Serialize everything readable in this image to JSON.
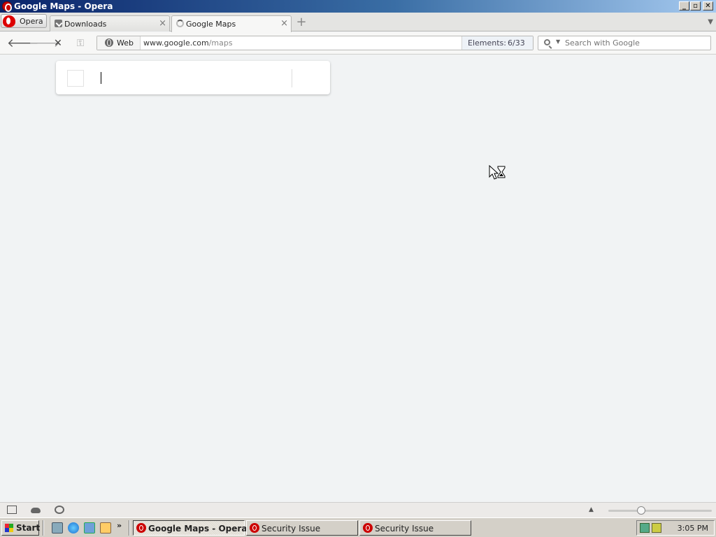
{
  "window": {
    "title": "Google Maps - Opera"
  },
  "tabbar": {
    "opera_menu_label": "Opera",
    "tabs": [
      {
        "label": "Downloads",
        "close": "×"
      },
      {
        "label": "Google Maps",
        "close": "×"
      }
    ],
    "new_tab": "+"
  },
  "navbar": {
    "back": "🡐",
    "forward": "🡒",
    "stop": "✕",
    "badge_label": "Web",
    "url_host": "www.google.com",
    "url_path": "/maps",
    "elements_label": "Elements:",
    "elements_count": "6/33",
    "search_placeholder": "Search with Google"
  },
  "maps": {
    "search_value": ""
  },
  "statusbar": {
    "up_arrow": "▲",
    "zoom_level": 0.3
  },
  "taskbar": {
    "start_label": "Start",
    "more": "»",
    "tasks": [
      {
        "label": "Google Maps - Opera"
      },
      {
        "label": "Security Issue"
      },
      {
        "label": "Security Issue"
      }
    ],
    "clock": "3:05 PM"
  }
}
